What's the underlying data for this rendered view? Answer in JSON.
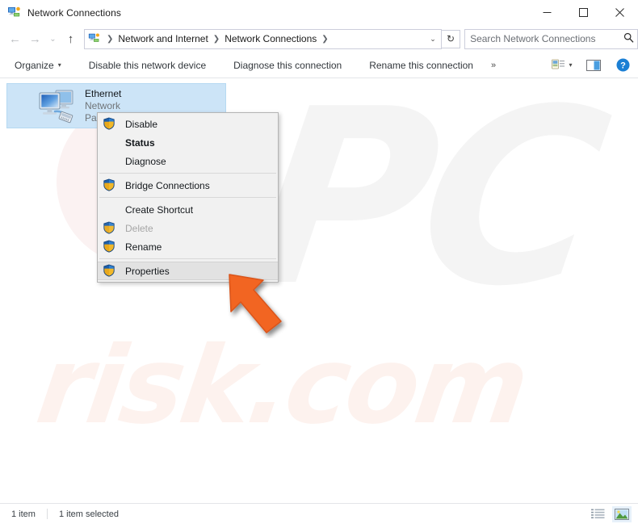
{
  "window": {
    "title": "Network Connections",
    "icon": "network-connections-icon",
    "controls": {
      "minimize": "—",
      "maximize": "☐",
      "close": "✕"
    }
  },
  "address_bar": {
    "back": "←",
    "forward": "→",
    "recent": "⌄",
    "up": "↑",
    "icon": "network-connections-icon",
    "crumbs": [
      "Network and Internet",
      "Network Connections"
    ],
    "separator": "❯",
    "trailing_separator": "❯",
    "dropdown": "⌄",
    "refresh": "↻"
  },
  "search": {
    "placeholder": "Search Network Connections",
    "value": "",
    "icon": "search-icon"
  },
  "command_bar": {
    "items": [
      {
        "label": "Organize",
        "has_caret": true
      },
      {
        "label": "Disable this network device",
        "has_caret": false
      },
      {
        "label": "Diagnose this connection",
        "has_caret": false
      },
      {
        "label": "Rename this connection",
        "has_caret": false
      }
    ],
    "overflow": "»",
    "view_options_icon": "change-view-icon",
    "view_options_caret": "▾",
    "preview_pane_icon": "preview-pane-icon",
    "help_icon": "help-icon",
    "help_glyph": "?"
  },
  "items": [
    {
      "name": "Ethernet",
      "network": "Network",
      "adapter": "Pa",
      "icon": "ethernet-adapter-icon",
      "selected": true
    }
  ],
  "context_menu": {
    "entries": [
      {
        "label": "Disable",
        "shield": true,
        "bold": false,
        "disabled": false,
        "hovered": false,
        "separator_after": false
      },
      {
        "label": "Status",
        "shield": false,
        "bold": true,
        "disabled": false,
        "hovered": false,
        "separator_after": false
      },
      {
        "label": "Diagnose",
        "shield": false,
        "bold": false,
        "disabled": false,
        "hovered": false,
        "separator_after": true
      },
      {
        "label": "Bridge Connections",
        "shield": true,
        "bold": false,
        "disabled": false,
        "hovered": false,
        "separator_after": true
      },
      {
        "label": "Create Shortcut",
        "shield": false,
        "bold": false,
        "disabled": false,
        "hovered": false,
        "separator_after": false
      },
      {
        "label": "Delete",
        "shield": true,
        "bold": false,
        "disabled": true,
        "hovered": false,
        "separator_after": false
      },
      {
        "label": "Rename",
        "shield": true,
        "bold": false,
        "disabled": false,
        "hovered": false,
        "separator_after": true
      },
      {
        "label": "Properties",
        "shield": true,
        "bold": false,
        "disabled": false,
        "hovered": true,
        "separator_after": false
      }
    ]
  },
  "status_bar": {
    "item_count": "1 item",
    "selection": "1 item selected",
    "view_details_icon": "details-view-icon",
    "view_large_icons_icon": "large-icons-view-icon"
  },
  "watermark": {
    "logo": "PC",
    "domain": "risk.com"
  },
  "annotation": {
    "pointer_icon": "orange-arrow-cursor",
    "points_at": "Properties"
  },
  "colors": {
    "selection": "#cce4f7",
    "menu_bg": "#f1f1f1",
    "menu_hover": "#e2e2e2",
    "accent": "#0078d7",
    "pointer_orange": "#f26522",
    "help_blue": "#1b7fd4"
  }
}
